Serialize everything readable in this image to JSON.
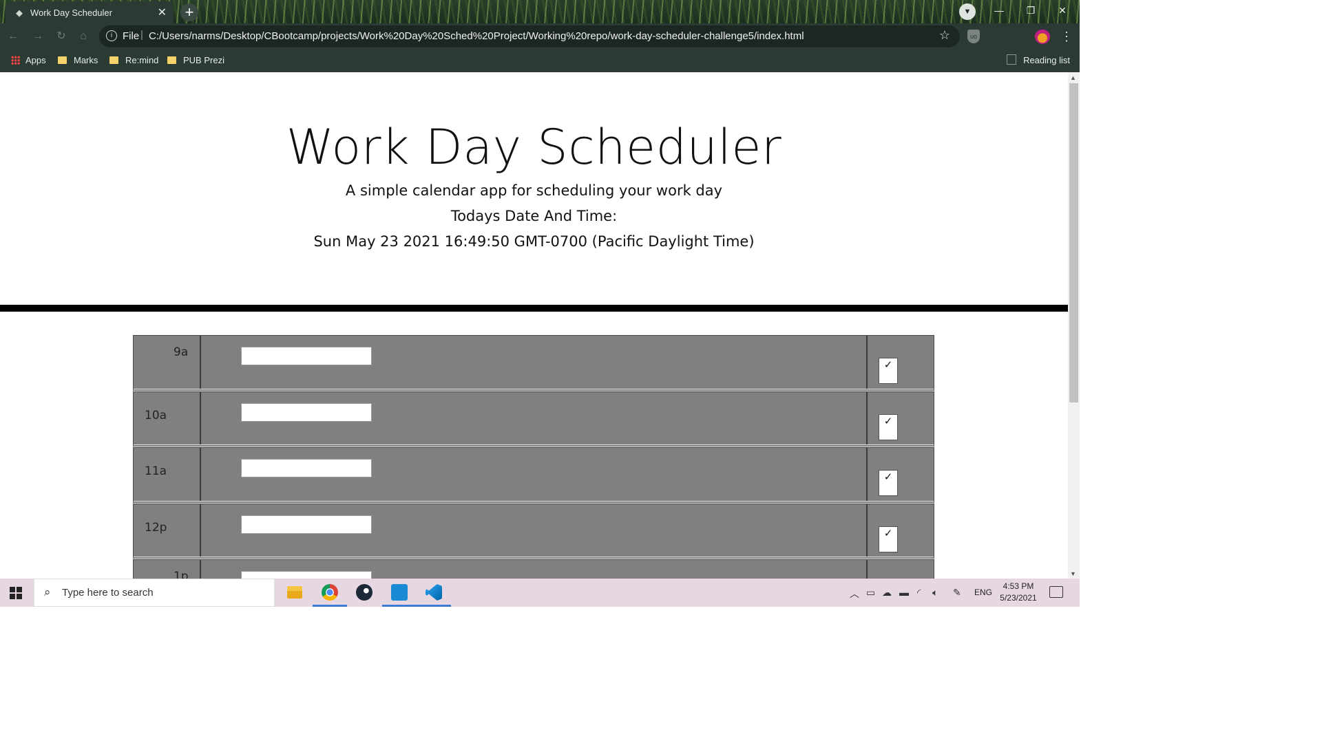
{
  "browser": {
    "tab_title": "Work Day Scheduler",
    "url_scheme_label": "File",
    "url": "C:/Users/narms/Desktop/CBootcamp/projects/Work%20Day%20Sched%20Project/Working%20repo/work-day-scheduler-challenge5/index.html",
    "bookmarks": [
      "Apps",
      "Marks",
      "Re:mind",
      "PUB Prezi"
    ],
    "reading_list": "Reading list"
  },
  "header": {
    "title": "Work Day Scheduler",
    "lead": "A simple calendar app for scheduling your work day",
    "date_label": "Todays Date And Time:",
    "date_value": "Sun May 23 2021 16:49:50 GMT-0700 (Pacific Daylight Time)"
  },
  "timeblocks": [
    {
      "hour": "9a",
      "text": "",
      "save_icon": "✓"
    },
    {
      "hour": "10a",
      "text": "",
      "save_icon": "✓"
    },
    {
      "hour": "11a",
      "text": "",
      "save_icon": "✓"
    },
    {
      "hour": "12p",
      "text": "",
      "save_icon": "✓"
    },
    {
      "hour": "1p",
      "text": "",
      "save_icon": "✓"
    }
  ],
  "taskbar": {
    "search_placeholder": "Type here to search",
    "language": "ENG",
    "time": "4:53 PM",
    "date": "5/23/2021"
  },
  "colors": {
    "timeblock_bg": "#808080",
    "divider": "#000000",
    "taskbar_bg": "#e6d7e2",
    "chrome_dark": "#2b3a33"
  }
}
